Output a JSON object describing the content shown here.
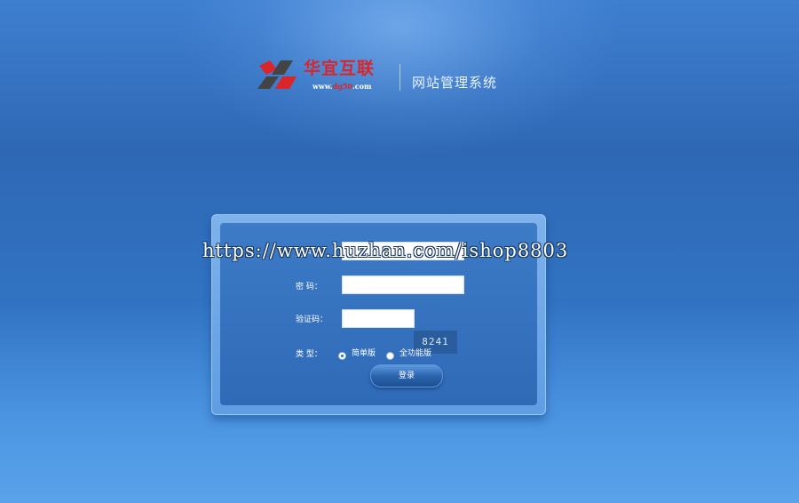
{
  "header": {
    "brand_name": "华宜互联",
    "brand_url_prefix": "www.",
    "brand_url_highlight": "dg50",
    "brand_url_suffix": ".com",
    "system_title": "网站管理系统"
  },
  "login_form": {
    "username_label": "用户名：",
    "username_value": "",
    "password_label": "密  码：",
    "password_value": "",
    "captcha_label": "验证码：",
    "captcha_value": "",
    "captcha_image_text": "8241",
    "type_label": "类  型：",
    "type_options": [
      {
        "label": "简单版",
        "selected": true
      },
      {
        "label": "全功能版",
        "selected": false
      }
    ],
    "submit_label": "登录"
  },
  "watermark": "https://www.huzhan.com/ishop8803",
  "colors": {
    "brand_red": "#d8262a",
    "background_blue": "#2e68b5",
    "panel_blue": "#3d7bc6"
  }
}
